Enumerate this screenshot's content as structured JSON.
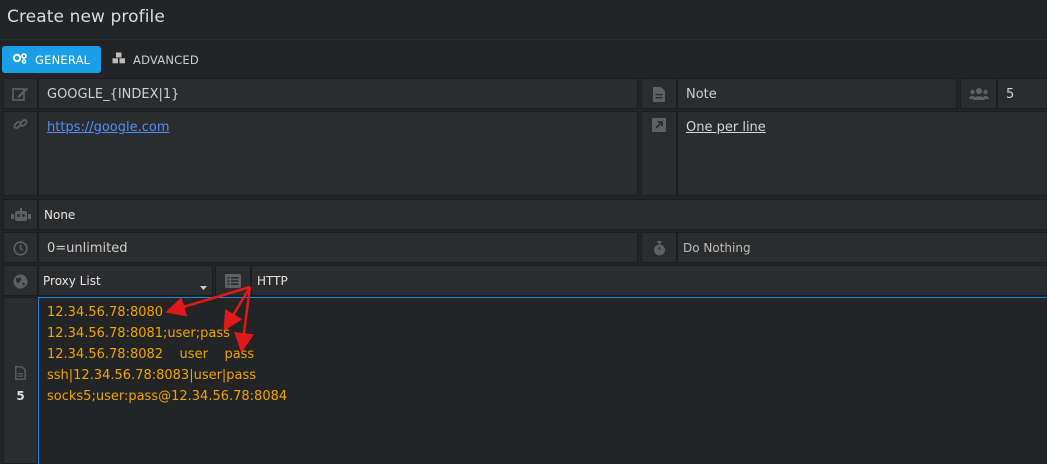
{
  "window": {
    "title": "Create new profile"
  },
  "tabs": [
    {
      "label": "GENERAL",
      "icon": "gears-icon",
      "active": true
    },
    {
      "label": "ADVANCED",
      "icon": "cubes-icon",
      "active": false
    }
  ],
  "form": {
    "name_value": "GOOGLE_{INDEX|1}",
    "note_value": "Note",
    "count_value": "5",
    "url_value": "https://google.com",
    "note_hint": "One per line",
    "fingerprint_value": "None",
    "limit_value": "0=unlimited",
    "action_value": "Do Nothing",
    "proxy_source": "Proxy List",
    "proxy_type": "HTTP",
    "proxy_line_count": "5"
  },
  "proxies": [
    "12.34.56.78:8080",
    "12.34.56.78:8081;user;pass",
    "12.34.56.78:8082    user    pass",
    "ssh|12.34.56.78:8083|user|pass",
    "socks5;user:pass@12.34.56.78:8084"
  ],
  "colors": {
    "accent": "#1a9ee6",
    "proxy_text": "#f0a500",
    "arrow": "#e01a1a",
    "link": "#4c90ff"
  }
}
